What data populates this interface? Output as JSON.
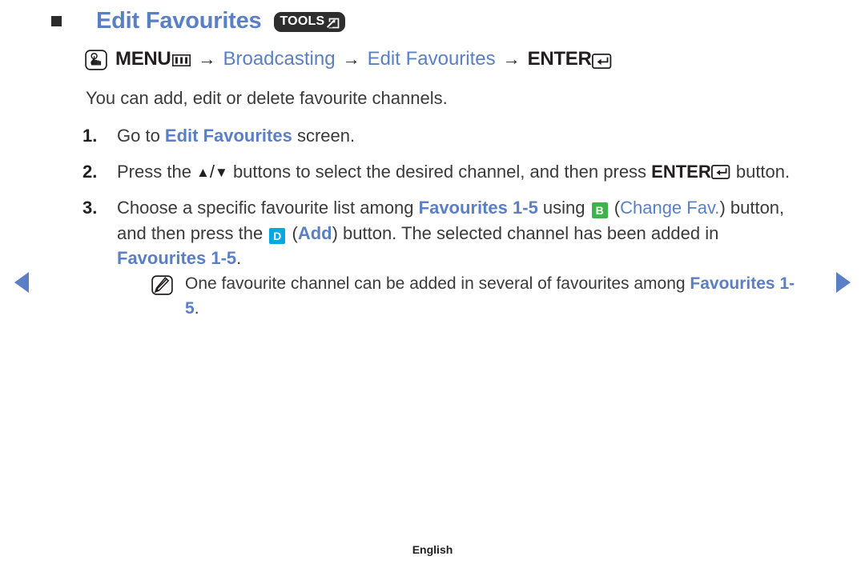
{
  "header": {
    "bullet_icon": "filled-square-bullet",
    "title": "Edit Favourites",
    "tools_badge_label": "TOOLS",
    "tools_badge_icon": "arrow-out-of-box-icon"
  },
  "menu_path": {
    "press_icon": "hand-press-button-icon",
    "menu_label": "MENU",
    "menu_icon": "menu-bars-icon",
    "separator": "→",
    "item1": "Broadcasting",
    "item2": "Edit Favourites",
    "enter_label": "ENTER",
    "enter_icon": "enter-return-key-icon"
  },
  "intro": "You can add, edit or delete favourite channels.",
  "steps": [
    {
      "number": "1.",
      "parts": [
        {
          "text": "Go to ",
          "style": "plain"
        },
        {
          "text": "Edit Favourites",
          "style": "blue-bold"
        },
        {
          "text": " screen.",
          "style": "plain"
        }
      ]
    },
    {
      "number": "2.",
      "parts": [
        {
          "text": "Press the ",
          "style": "plain"
        },
        {
          "text": "▲",
          "style": "glyph"
        },
        {
          "text": "/",
          "style": "plain"
        },
        {
          "text": "▼",
          "style": "glyph"
        },
        {
          "text": " buttons to select the desired channel, and then press ",
          "style": "plain"
        },
        {
          "text": "ENTER",
          "style": "dark-bold"
        },
        {
          "text": "enter-return-key-icon",
          "style": "enter-icon"
        },
        {
          "text": " button.",
          "style": "plain"
        }
      ]
    },
    {
      "number": "3.",
      "parts": [
        {
          "text": "Choose a specific favourite list among ",
          "style": "plain"
        },
        {
          "text": "Favourites 1-5",
          "style": "blue-bold"
        },
        {
          "text": " using ",
          "style": "plain"
        },
        {
          "text": "B",
          "style": "key-b"
        },
        {
          "text": " (",
          "style": "plain"
        },
        {
          "text": "Change Fav.",
          "style": "blue-plain"
        },
        {
          "text": ") button, and then press the ",
          "style": "plain"
        },
        {
          "text": "D",
          "style": "key-d"
        },
        {
          "text": " (",
          "style": "plain"
        },
        {
          "text": "Add",
          "style": "blue-bold"
        },
        {
          "text": ") button. The selected channel has been added in ",
          "style": "plain"
        },
        {
          "text": "Favourites 1-5",
          "style": "blue-bold"
        },
        {
          "text": ".",
          "style": "plain"
        }
      ]
    }
  ],
  "note": {
    "icon": "note-pencil-icon",
    "parts": [
      {
        "text": "One favourite channel can be added in several of favourites among ",
        "style": "plain"
      },
      {
        "text": "Favourites 1-5",
        "style": "blue-bold"
      },
      {
        "text": ".",
        "style": "plain"
      }
    ]
  },
  "navigation": {
    "prev_icon": "previous-page-arrow-icon",
    "next_icon": "next-page-arrow-icon"
  },
  "footer": {
    "language": "English"
  },
  "colors": {
    "accent_blue": "#5b7fc4",
    "key_b_green": "#3cb44b",
    "key_d_cyan": "#00a9e0",
    "text_dark": "#231f20",
    "body_text": "#3a3a3a",
    "badge_dark": "#2e2e2e"
  }
}
